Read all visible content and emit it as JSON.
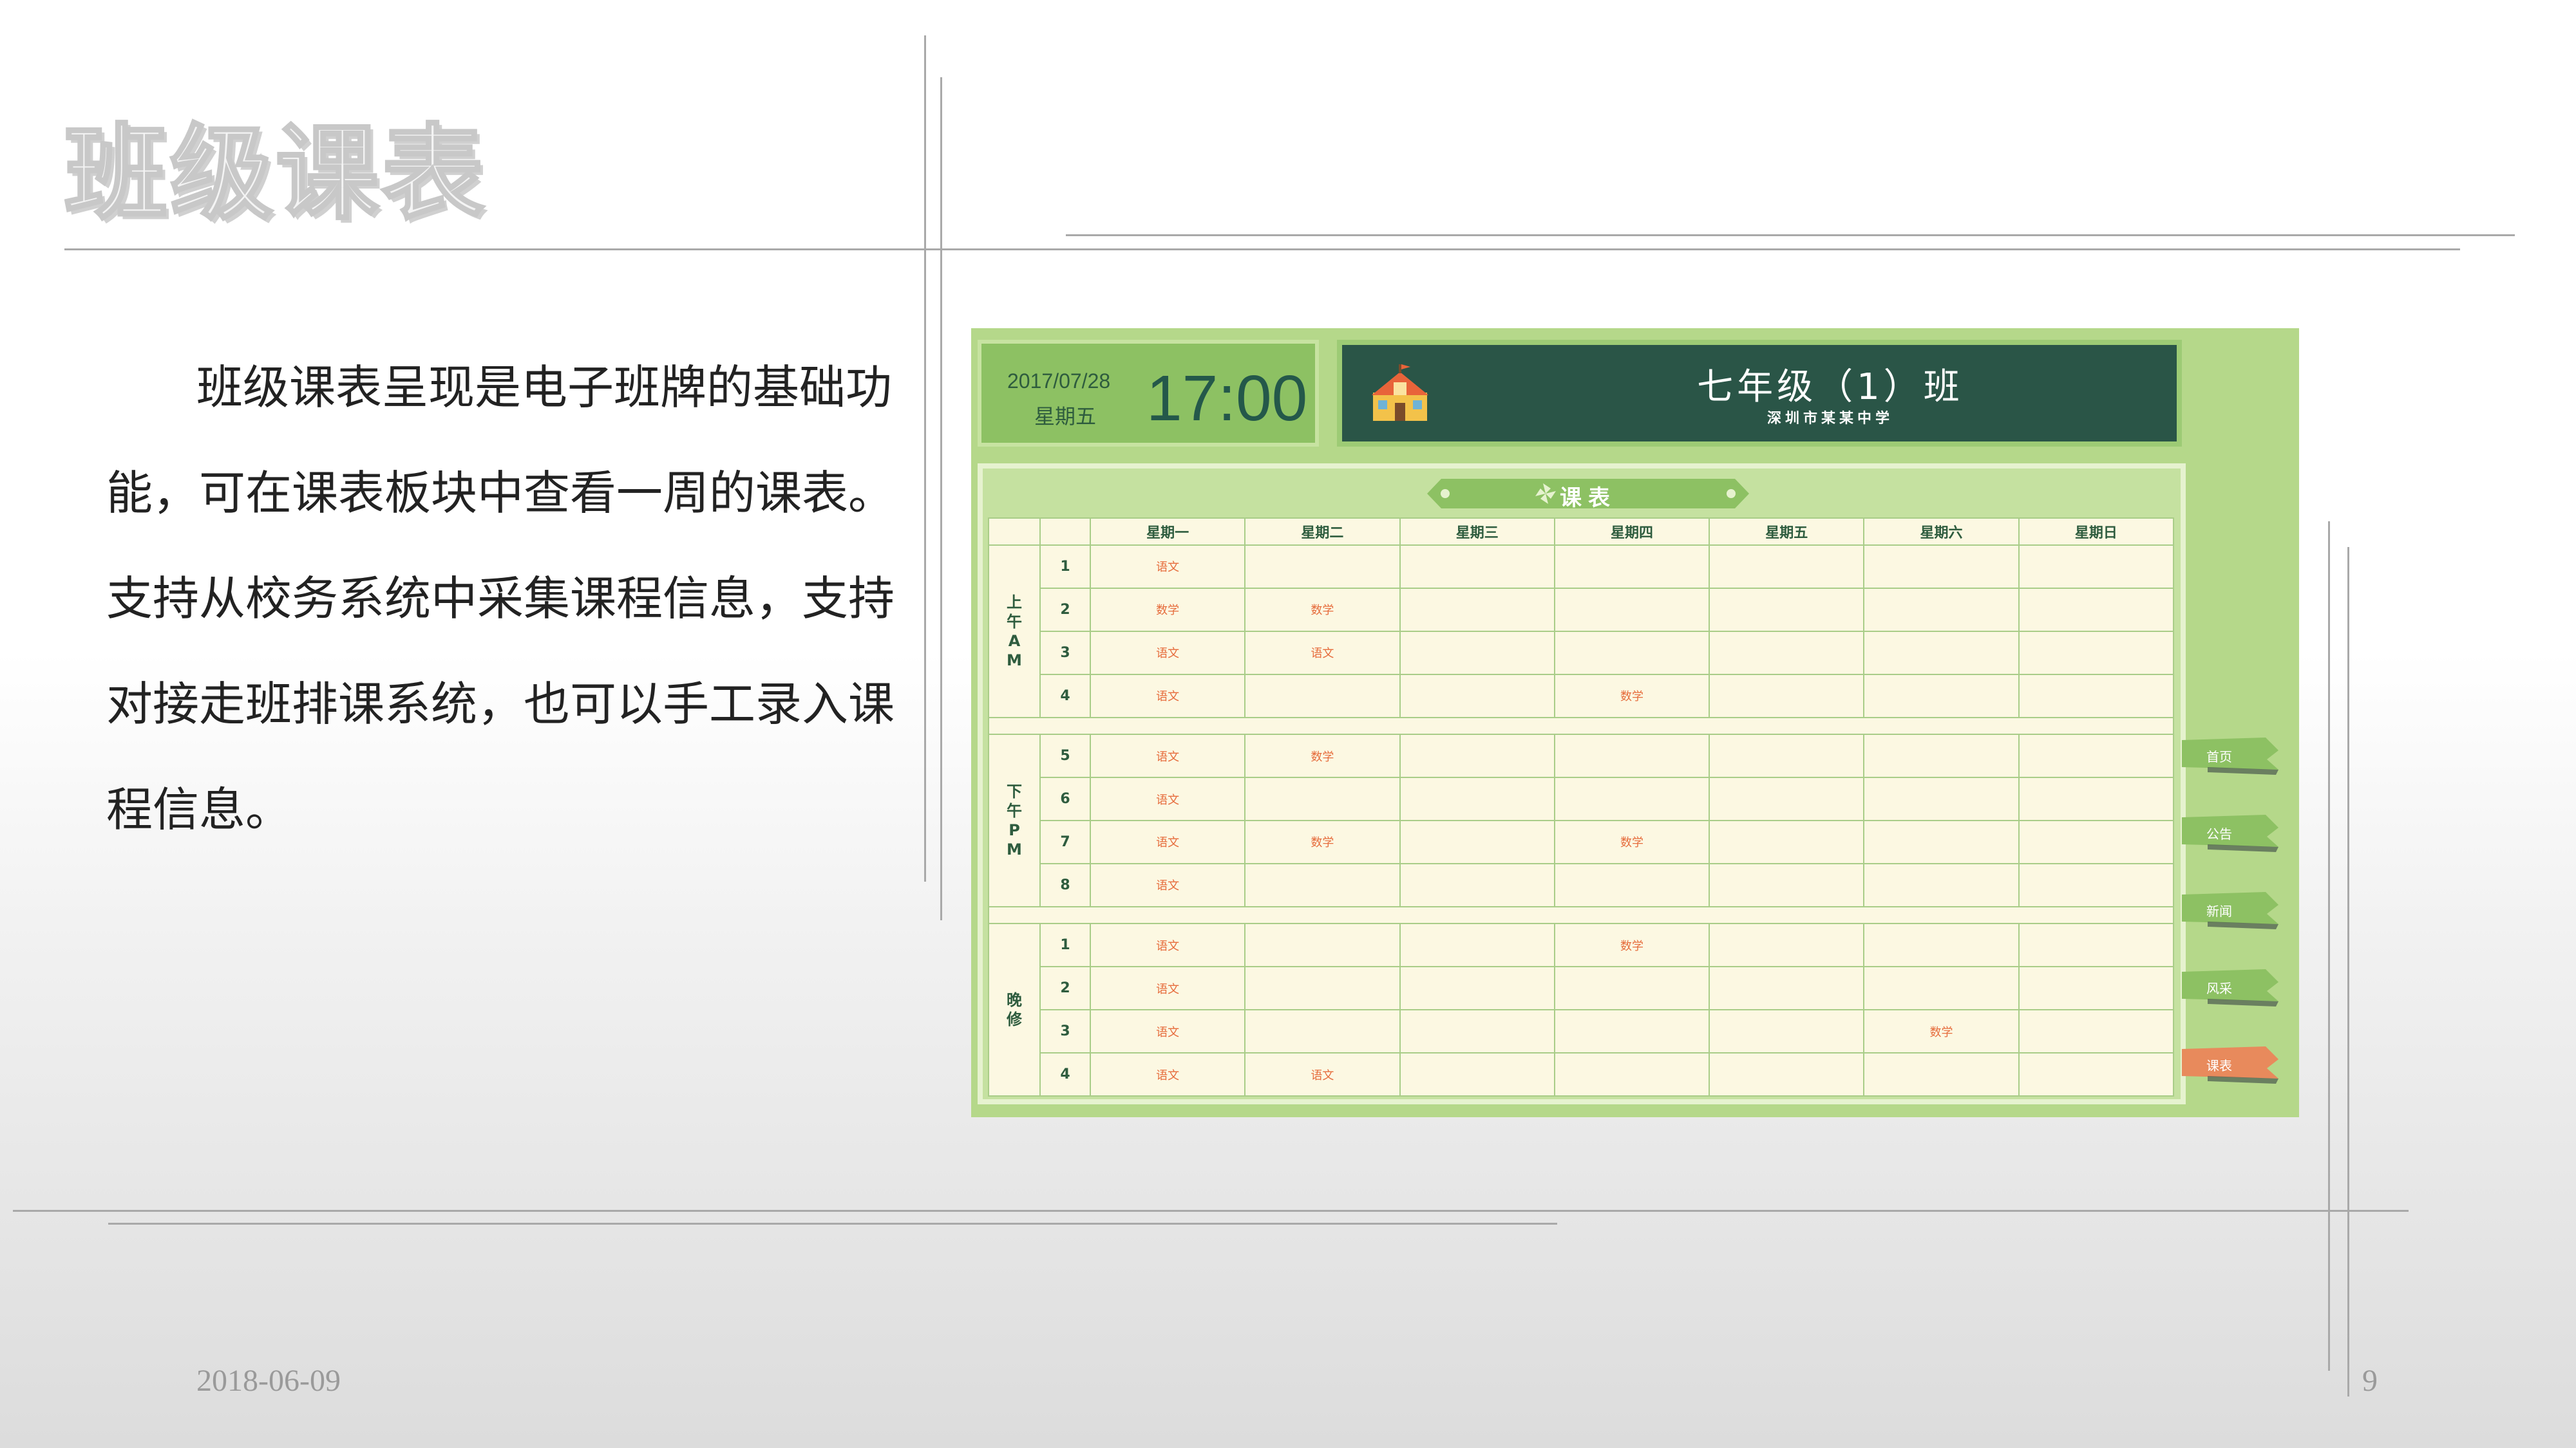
{
  "page": {
    "title": "班级课表",
    "body": "班级课表呈现是电子班牌的基础功能，可在课表板块中查看一周的课表。支持从校务系统中采集课程信息，支持对接走班排课系统，也可以手工录入课程信息。",
    "footer_date": "2018-06-09",
    "page_number": "9"
  },
  "board": {
    "date": "2017/07/28",
    "weekday": "星期五",
    "time": "17:00",
    "class_name": "七年级（1）班",
    "school_name": "深圳市某某中学",
    "timetable_title": "课表",
    "days": [
      "星期一",
      "星期二",
      "星期三",
      "星期四",
      "星期五",
      "星期六",
      "星期日"
    ],
    "sections": [
      {
        "label": "上午AM",
        "rows": [
          {
            "period": "1",
            "cells": [
              "语文",
              "",
              "",
              "",
              "",
              "",
              ""
            ]
          },
          {
            "period": "2",
            "cells": [
              "数学",
              "数学",
              "",
              "",
              "",
              "",
              ""
            ]
          },
          {
            "period": "3",
            "cells": [
              "语文",
              "语文",
              "",
              "",
              "",
              "",
              ""
            ]
          },
          {
            "period": "4",
            "cells": [
              "语文",
              "",
              "",
              "数学",
              "",
              "",
              ""
            ]
          }
        ]
      },
      {
        "label": "下午PM",
        "rows": [
          {
            "period": "5",
            "cells": [
              "语文",
              "数学",
              "",
              "",
              "",
              "",
              ""
            ]
          },
          {
            "period": "6",
            "cells": [
              "语文",
              "",
              "",
              "",
              "",
              "",
              ""
            ]
          },
          {
            "period": "7",
            "cells": [
              "语文",
              "数学",
              "",
              "数学",
              "",
              "",
              ""
            ]
          },
          {
            "period": "8",
            "cells": [
              "语文",
              "",
              "",
              "",
              "",
              "",
              ""
            ]
          }
        ]
      },
      {
        "label": "晚修",
        "rows": [
          {
            "period": "1",
            "cells": [
              "语文",
              "",
              "",
              "数学",
              "",
              "",
              ""
            ]
          },
          {
            "period": "2",
            "cells": [
              "语文",
              "",
              "",
              "",
              "",
              "",
              ""
            ]
          },
          {
            "period": "3",
            "cells": [
              "语文",
              "",
              "",
              "",
              "",
              "数学",
              ""
            ]
          },
          {
            "period": "4",
            "cells": [
              "语文",
              "语文",
              "",
              "",
              "",
              "",
              ""
            ]
          }
        ]
      }
    ],
    "nav": [
      {
        "label": "首页",
        "active": false
      },
      {
        "label": "公告",
        "active": false
      },
      {
        "label": "新闻",
        "active": false
      },
      {
        "label": "风采",
        "active": false
      },
      {
        "label": "课表",
        "active": true
      }
    ]
  },
  "colors": {
    "board_green": "#b5d88a",
    "header_dark": "#2a5547",
    "cell_bg": "#fcf8e2",
    "course_text": "#e66c3c",
    "nav_green": "#8dc163",
    "nav_active": "#e88a5c"
  }
}
